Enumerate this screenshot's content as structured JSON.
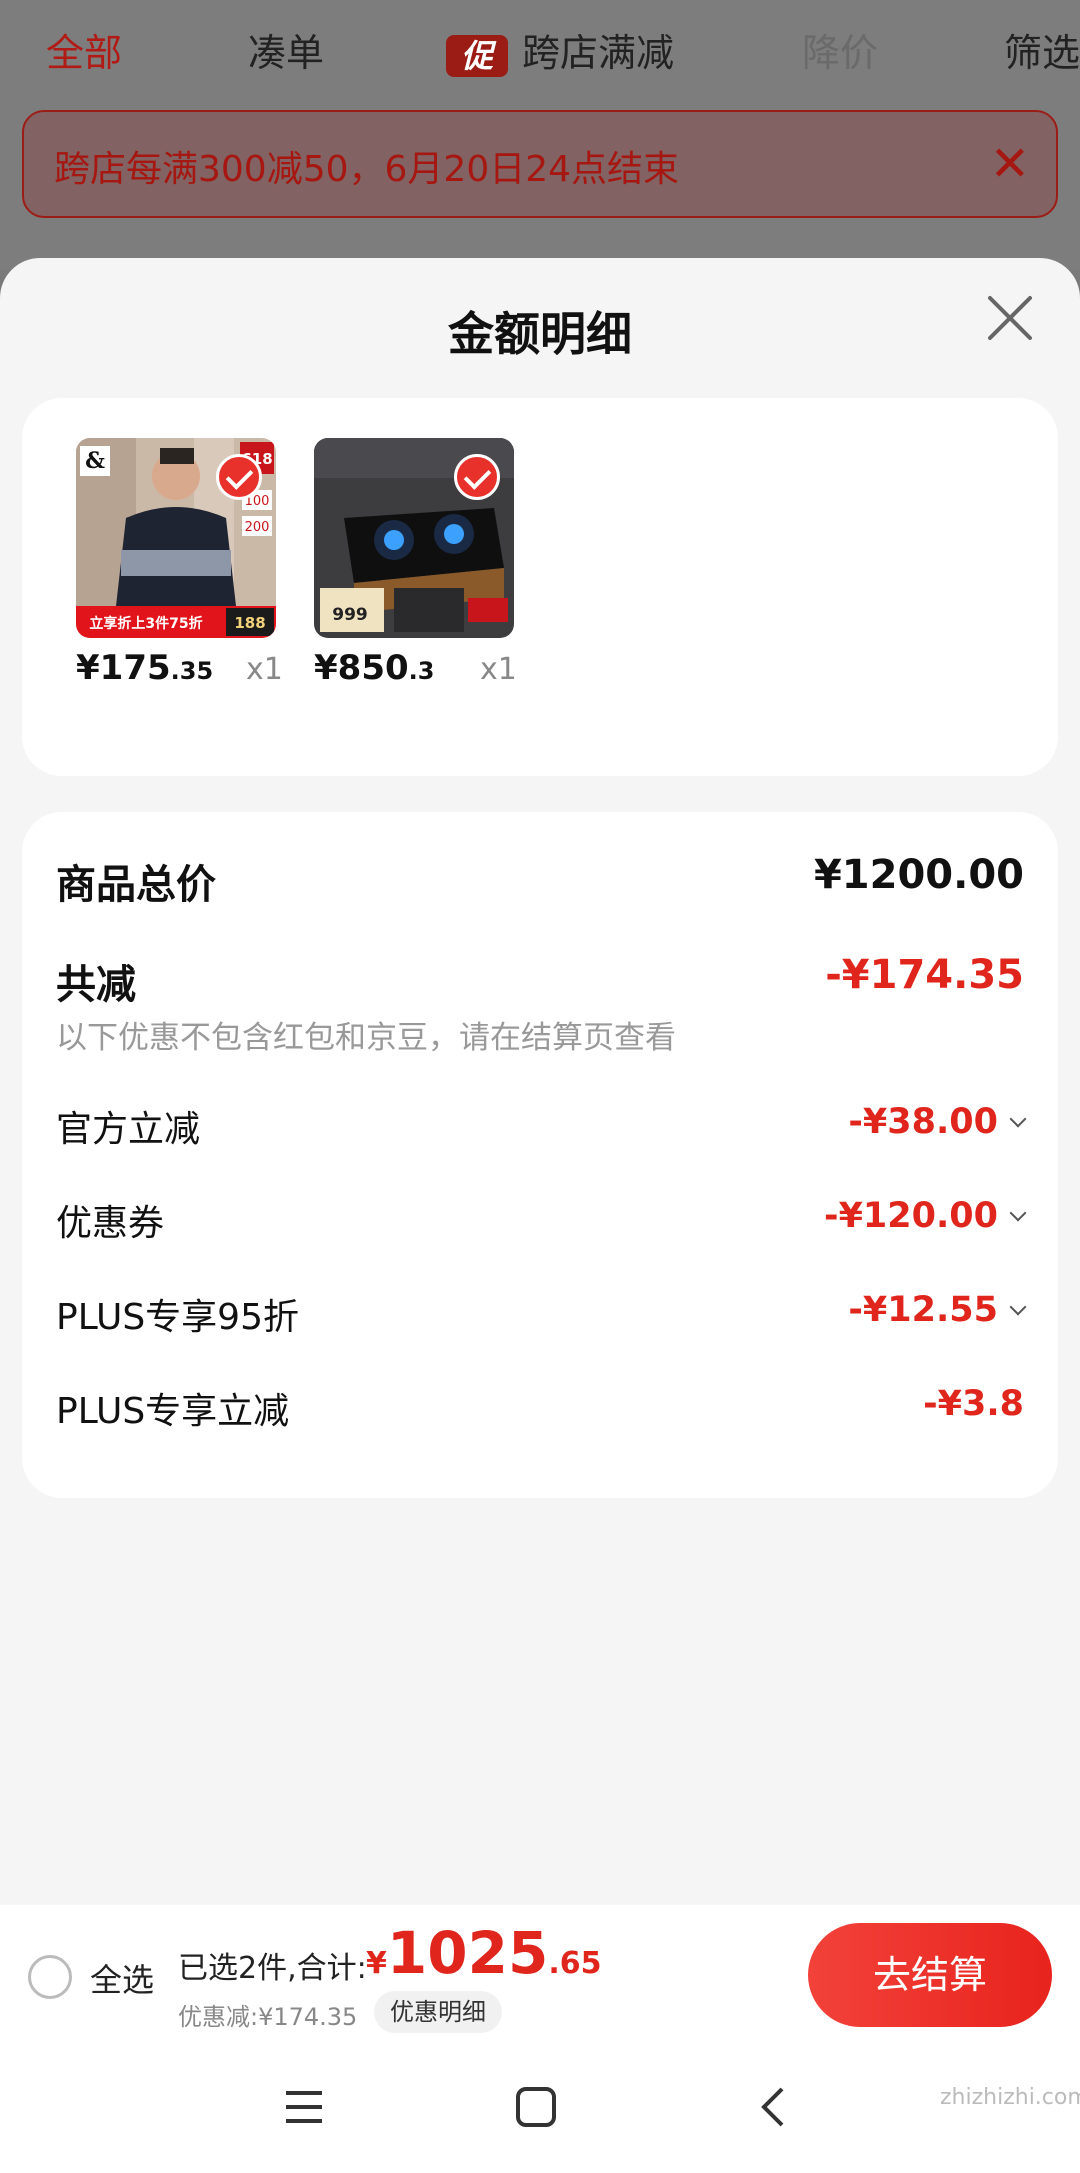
{
  "top_tabs": [
    {
      "label": "全部",
      "state": "active"
    },
    {
      "label": "凑单",
      "state": "normal"
    },
    {
      "label": "跨店满减",
      "state": "normal",
      "chip": "促"
    },
    {
      "label": "降价",
      "state": "muted"
    },
    {
      "label": "筛选",
      "state": "normal"
    }
  ],
  "notice": {
    "text": "跨店每满300减50，6月20日24点结束",
    "close_icon": "close-icon"
  },
  "sheet": {
    "title": "金额明细"
  },
  "products": [
    {
      "price_int": "¥175",
      "price_dec": ".35",
      "qty": "x1",
      "badge_top": "618",
      "badge_vals": [
        "100",
        "200"
      ],
      "tag": "立享折上3件75折",
      "price_tag": "188"
    },
    {
      "price_int": "¥850",
      "price_dec": ".3",
      "qty": "x1",
      "price_tag": "999"
    }
  ],
  "summary": {
    "total_label": "商品总价",
    "total_value": "¥1200.00",
    "discount_label": "共减",
    "discount_value": "-¥174.35",
    "note": "以下优惠不包含红包和京豆，请在结算页查看",
    "items": [
      {
        "label": "官方立减",
        "value": "-¥38.00"
      },
      {
        "label": "优惠券",
        "value": "-¥120.00"
      },
      {
        "label": "PLUS专享95折",
        "value": "-¥12.55"
      },
      {
        "label": "PLUS专享立减",
        "value": "-¥3.8"
      }
    ]
  },
  "bottom": {
    "select_all": "全选",
    "selected_text": "已选2件,合计:",
    "currency": "¥",
    "total_int": "1025",
    "total_dec": ".65",
    "discount_text": "优惠减:¥174.35",
    "detail_button": "优惠明细",
    "checkout_button": "去结算"
  },
  "watermark": "zhizhizhi.com",
  "colors": {
    "accent": "#e0261c",
    "checkout": "#f0302a"
  }
}
